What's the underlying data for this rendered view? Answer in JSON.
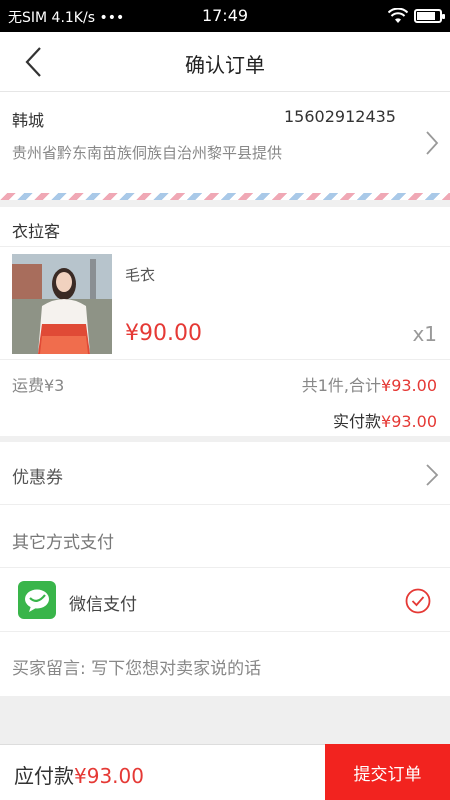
{
  "status_bar": {
    "left": "无SIM 4.1K/s •••",
    "time": "17:49"
  },
  "nav": {
    "title": "确认订单"
  },
  "address": {
    "name": "韩城",
    "phone": "15602912435",
    "detail": "贵州省黔东南苗族侗族自治州黎平县提供"
  },
  "shop": {
    "name": "衣拉客"
  },
  "product": {
    "name": "毛衣",
    "price": "¥90.00",
    "quantity": "x1"
  },
  "summary": {
    "freight": "运费¥3",
    "total_prefix": "共1件,合计",
    "total_amount": "¥93.00",
    "paid_prefix": "实付款",
    "paid_amount": "¥93.00"
  },
  "coupon": {
    "label": "优惠券"
  },
  "other_payment": {
    "label": "其它方式支付"
  },
  "wechat_pay": {
    "label": "微信支付"
  },
  "message": {
    "text": "买家留言: 写下您想对卖家说的话"
  },
  "bottom_bar": {
    "payable_prefix": "应付款",
    "payable_amount": "¥93.00",
    "submit_label": "提交订单"
  },
  "colors": {
    "accent": "#e53935",
    "submit_bg": "#f2231f",
    "wechat_green": "#39b54a"
  }
}
